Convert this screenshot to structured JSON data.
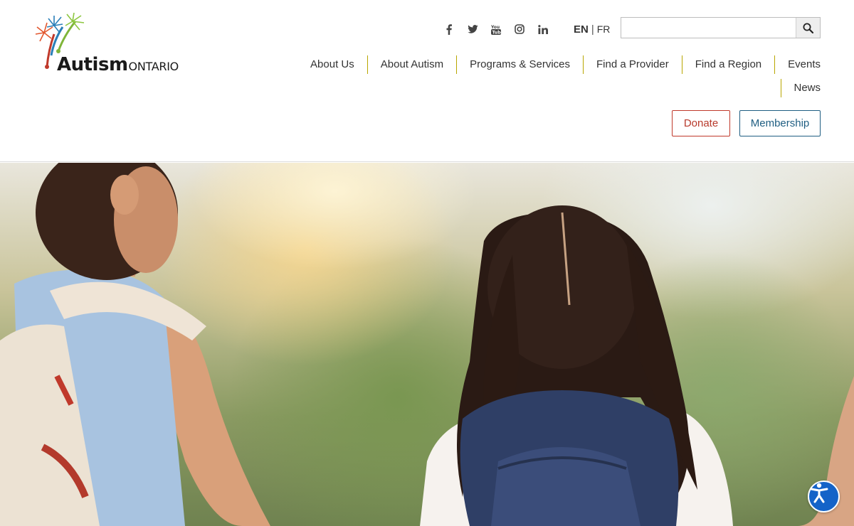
{
  "brand": {
    "word_main": "Autism",
    "word_sub": "ONTARIO"
  },
  "social": [
    {
      "icon": "facebook-icon",
      "glyph": "f"
    },
    {
      "icon": "twitter-icon",
      "glyph": "t"
    },
    {
      "icon": "youtube-icon",
      "glyph": "You"
    },
    {
      "icon": "instagram-icon",
      "glyph": "ig"
    },
    {
      "icon": "linkedin-icon",
      "glyph": "in"
    }
  ],
  "language": {
    "en": "EN",
    "separator": "|",
    "fr": "FR"
  },
  "search": {
    "value": "",
    "placeholder": ""
  },
  "nav": {
    "items": [
      "About Us",
      "About Autism",
      "Programs & Services",
      "Find a Provider",
      "Find a Region",
      "Events",
      "News"
    ]
  },
  "actions": {
    "donate": "Donate",
    "membership": "Membership"
  },
  "colors": {
    "nav_divider": "#b9a600",
    "donate": "#b83a2c",
    "membership": "#1f5e82",
    "accessibility_button": "#1463c8"
  },
  "accessibility": {
    "icon": "accessibility-icon"
  }
}
